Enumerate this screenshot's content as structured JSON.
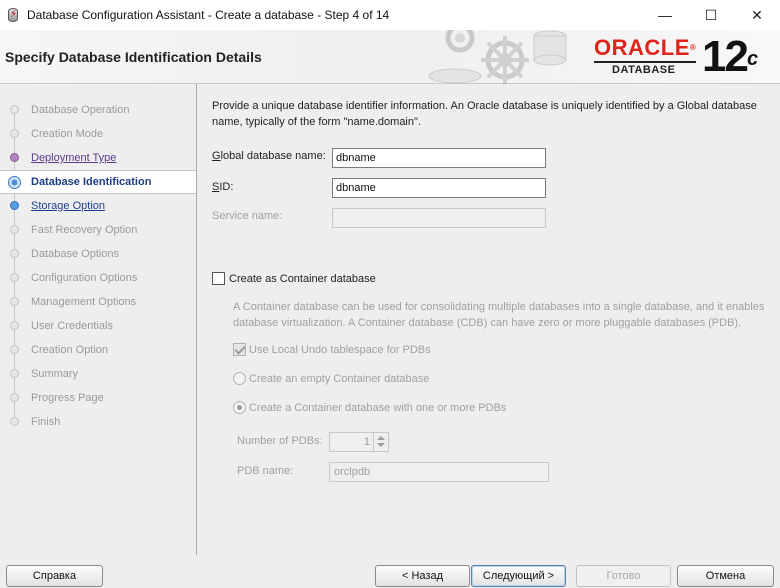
{
  "window": {
    "title": "Database Configuration Assistant - Create a database - Step 4 of 14",
    "minimize_glyph": "—",
    "maximize_glyph": "☐",
    "close_glyph": "✕",
    "app_icon": "database-lightning-icon"
  },
  "header": {
    "title": "Specify Database Identification Details",
    "brand": "ORACLE",
    "brand_mark": "®",
    "product": "DATABASE",
    "version_number": "12",
    "version_suffix": "c",
    "brand_color": "#e2231a"
  },
  "nav": {
    "items": [
      {
        "label": "Database Operation",
        "state": "done"
      },
      {
        "label": "Creation Mode",
        "state": "done"
      },
      {
        "label": "Deployment Type",
        "state": "visited"
      },
      {
        "label": "Database Identification",
        "state": "current"
      },
      {
        "label": "Storage Option",
        "state": "next"
      },
      {
        "label": "Fast Recovery Option",
        "state": "pending"
      },
      {
        "label": "Database Options",
        "state": "pending"
      },
      {
        "label": "Configuration Options",
        "state": "pending"
      },
      {
        "label": "Management Options",
        "state": "pending"
      },
      {
        "label": "User Credentials",
        "state": "pending"
      },
      {
        "label": "Creation Option",
        "state": "pending"
      },
      {
        "label": "Summary",
        "state": "pending"
      },
      {
        "label": "Progress Page",
        "state": "pending"
      },
      {
        "label": "Finish",
        "state": "pending"
      }
    ]
  },
  "form": {
    "intro": "Provide a unique database identifier information. An Oracle database is uniquely identified by a Global database name, typically of the form \"name.domain\".",
    "global_db_name": {
      "label_mnemonic": "G",
      "label_rest": "lobal database name:",
      "value": "dbname"
    },
    "sid": {
      "label_mnemonic": "S",
      "label_rest": "ID:",
      "value": "dbname"
    },
    "service_name": {
      "label": "Service name:",
      "value": ""
    },
    "container": {
      "checkbox_label": "Create as Container database",
      "checked": false,
      "description": "A Container database can be used for consolidating multiple databases into a single database, and it enables database virtualization. A Container database (CDB) can have zero or more pluggable databases (PDB).",
      "local_undo_label": "Use Local Undo tablespace for PDBs",
      "local_undo_checked": true,
      "empty_cdb_label": "Create an empty Container database",
      "with_pdbs_label": "Create a Container database with one or more PDBs",
      "selected_option": "with_pdbs",
      "num_pdbs_label": "Number of PDBs:",
      "num_pdbs_value": "1",
      "pdb_name_label": "PDB name:",
      "pdb_name_value": "orclpdb"
    }
  },
  "footer": {
    "help_label": "Справка",
    "back_label": "< Назад",
    "next_label": "Следующий >",
    "finish_label": "Готово",
    "cancel_label": "Отмена"
  }
}
